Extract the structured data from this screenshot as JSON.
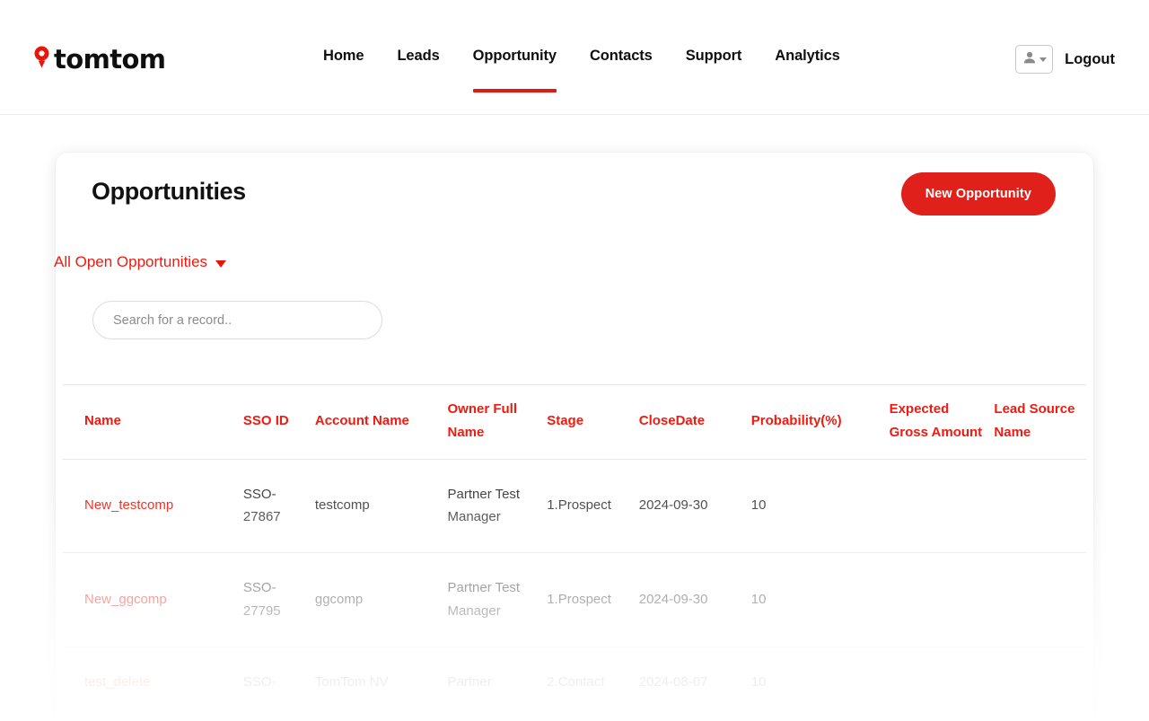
{
  "brand": {
    "name": "tomtom",
    "pin_icon": "map-pin-icon",
    "pin_color": "#e8150b"
  },
  "nav": {
    "items": [
      {
        "label": "Home",
        "active": false
      },
      {
        "label": "Leads",
        "active": false
      },
      {
        "label": "Opportunity",
        "active": true
      },
      {
        "label": "Contacts",
        "active": false
      },
      {
        "label": "Support",
        "active": false
      },
      {
        "label": "Analytics",
        "active": false
      }
    ],
    "active_underline_color": "#df1b12",
    "avatar_icon": "user-avatar-icon",
    "avatar_caret_icon": "chevron-down-icon",
    "logout_label": "Logout"
  },
  "card": {
    "title": "Opportunities",
    "new_button_label": "New Opportunity",
    "new_button_color": "#e0201a",
    "list_view": {
      "label": "All Open Opportunities",
      "caret_icon": "caret-down-icon",
      "color": "#f01a10"
    },
    "search": {
      "placeholder": "Search for a record..",
      "value": ""
    }
  },
  "table": {
    "columns": [
      {
        "key": "name",
        "label": "Name"
      },
      {
        "key": "sso",
        "label": "SSO ID"
      },
      {
        "key": "acct",
        "label": "Account Name"
      },
      {
        "key": "owner",
        "label": "Owner Full Name"
      },
      {
        "key": "stage",
        "label": "Stage"
      },
      {
        "key": "close",
        "label": "CloseDate"
      },
      {
        "key": "prob",
        "label": "Probability(%)"
      },
      {
        "key": "amount",
        "label": "Expected Gross Amount"
      },
      {
        "key": "lead",
        "label": "Lead Source Name"
      }
    ],
    "header_color": "#f01a10",
    "rows": [
      {
        "name": "New_testcomp",
        "sso": "SSO-27867",
        "acct": "testcomp",
        "owner": "Partner Test Manager",
        "stage": "1.Prospect",
        "close": "2024-09-30",
        "prob": "10",
        "amount": "",
        "lead": ""
      },
      {
        "name": "New_ggcomp",
        "sso": "SSO-27795",
        "acct": "ggcomp",
        "owner": "Partner Test Manager",
        "stage": "1.Prospect",
        "close": "2024-09-30",
        "prob": "10",
        "amount": "",
        "lead": ""
      },
      {
        "name": "test_delete",
        "sso": "SSO-",
        "acct": "TomTom NV",
        "owner": "Partner",
        "stage": "2.Contact",
        "close": "2024-08-07",
        "prob": "10",
        "amount": "",
        "lead": ""
      }
    ]
  }
}
